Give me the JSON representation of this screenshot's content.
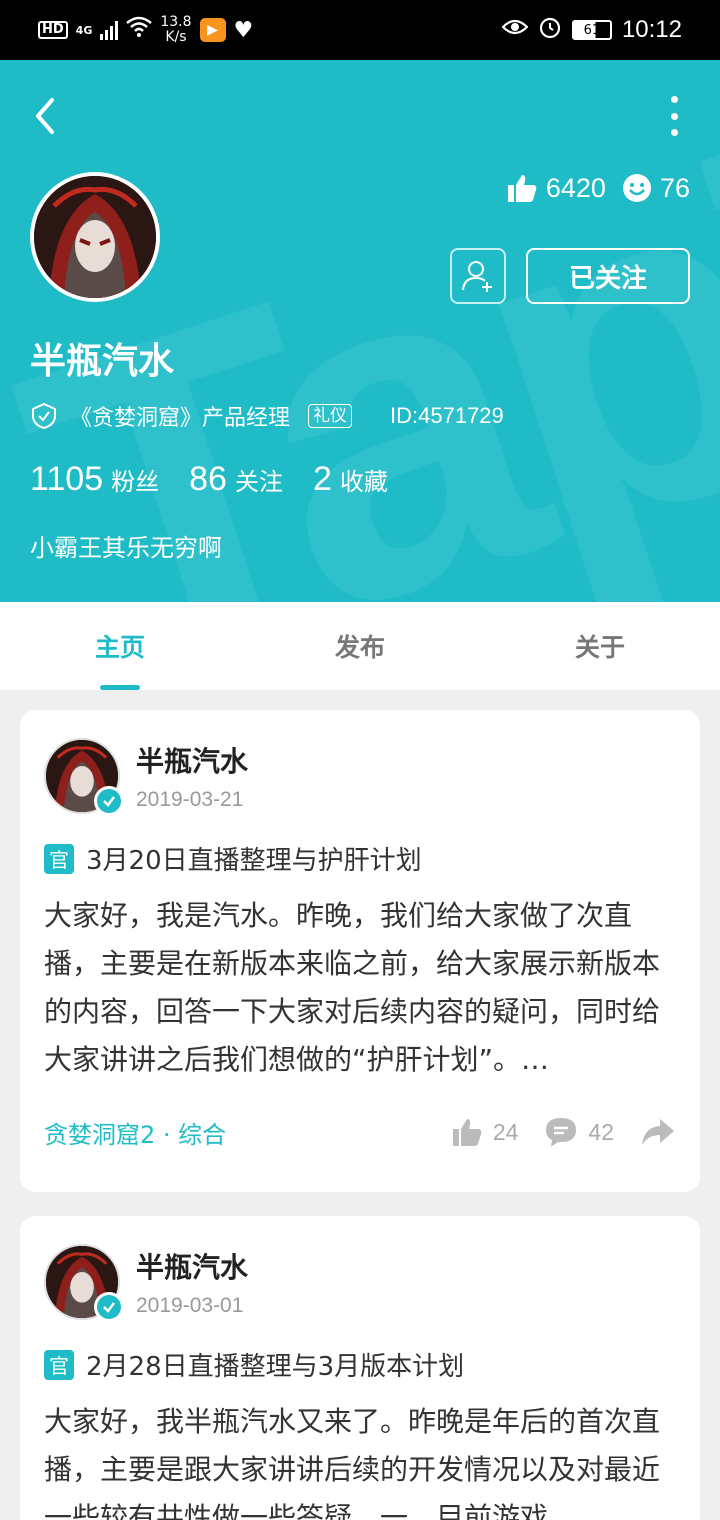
{
  "status_bar": {
    "hd": "HD",
    "network": "4G",
    "speed_value": "13.8",
    "speed_unit": "K/s",
    "battery": "61",
    "time": "10:12"
  },
  "profile": {
    "name": "半瓶汽水",
    "likes": "6420",
    "smiles": "76",
    "follow_label": "已关注",
    "title": "《贪婪洞窟》产品经理",
    "role_badge": "礼仪",
    "id": "ID:4571729",
    "fans_count": "1105",
    "fans_label": "粉丝",
    "following_count": "86",
    "following_label": "关注",
    "favorites_count": "2",
    "favorites_label": "收藏",
    "bio": "小霸王其乐无穷啊"
  },
  "tabs": [
    {
      "label": "主页",
      "active": true
    },
    {
      "label": "发布",
      "active": false
    },
    {
      "label": "关于",
      "active": false
    }
  ],
  "posts": [
    {
      "author": "半瓶汽水",
      "date": "2019-03-21",
      "badge": "官",
      "title": "3月20日直播整理与护肝计划",
      "body": "大家好，我是汽水。昨晚，我们给大家做了次直播，主要是在新版本来临之前，给大家展示新版本的内容，回答一下大家对后续内容的疑问，同时给大家讲讲之后我们想做的“护肝计划”。…",
      "category": "贪婪洞窟2 · 综合",
      "likes": "24",
      "comments": "42"
    },
    {
      "author": "半瓶汽水",
      "date": "2019-03-01",
      "badge": "官",
      "title": "2月28日直播整理与3月版本计划",
      "body": "大家好，我半瓶汽水又来了。昨晚是年后的首次直播，主要是跟大家讲讲后续的开发情况以及对最近一些较有共性做一些答疑。一、目前游戏",
      "category": "",
      "likes": "",
      "comments": ""
    }
  ],
  "colors": {
    "accent": "#1fbcc8",
    "background": "#efefef"
  }
}
